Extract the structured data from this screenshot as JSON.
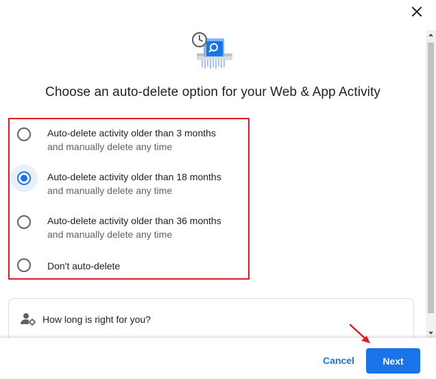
{
  "dialog": {
    "close_icon": "close-icon",
    "hero_icon": "auto-delete-history-icon",
    "title": "Choose an auto-delete option for your Web & App Activity",
    "options": [
      {
        "label": "Auto-delete activity older than 3 months",
        "sublabel": "and manually delete any time",
        "selected": false
      },
      {
        "label": "Auto-delete activity older than 18 months",
        "sublabel": "and manually delete any time",
        "selected": true
      },
      {
        "label": "Auto-delete activity older than 36 months",
        "sublabel": "and manually delete any time",
        "selected": false
      },
      {
        "label": "Don't auto-delete",
        "sublabel": "",
        "selected": false
      }
    ],
    "info": {
      "icon": "person-settings-icon",
      "title": "How long is right for you?"
    },
    "footer": {
      "cancel_label": "Cancel",
      "next_label": "Next"
    }
  },
  "colors": {
    "accent": "#1a73e8",
    "highlight_border": "#e01b24",
    "annotation_arrow": "#e01b24"
  }
}
